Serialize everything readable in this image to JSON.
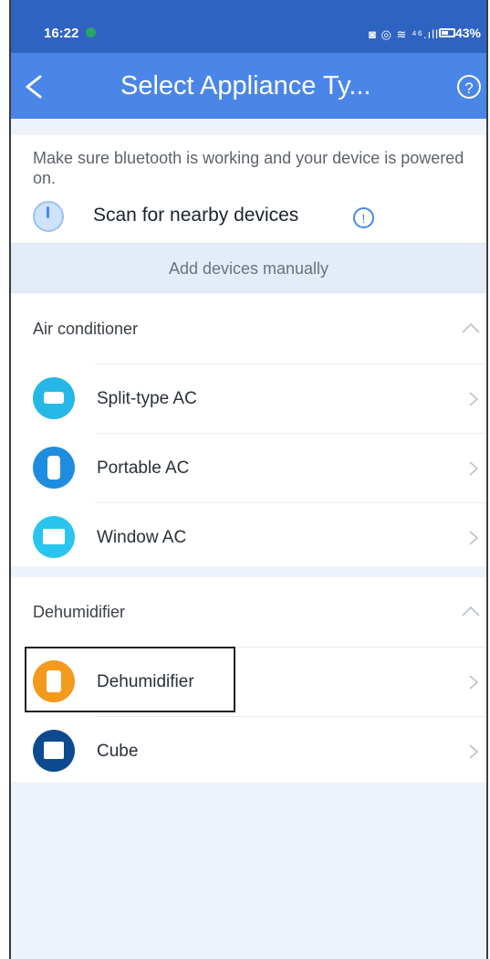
{
  "status_bar": {
    "time": "16:22",
    "icons": "◙ ◎ ≋ ⁴⁶.ıll",
    "battery": "43%"
  },
  "header": {
    "title": "Select Appliance Ty...",
    "help": "?"
  },
  "scan": {
    "hint": "Make sure bluetooth is working and your device is powered on.",
    "label": "Scan for nearby devices",
    "info": "!"
  },
  "manual": {
    "label": "Add devices manually"
  },
  "sections": [
    {
      "title": "Air conditioner",
      "items": [
        {
          "label": "Split-type AC",
          "icon": "split-ac-icon",
          "color": "#27b7e6"
        },
        {
          "label": "Portable AC",
          "icon": "portable-ac-icon",
          "color": "#1e8de0"
        },
        {
          "label": "Window AC",
          "icon": "window-ac-icon",
          "color": "#2ac5ee"
        }
      ]
    },
    {
      "title": "Dehumidifier",
      "items": [
        {
          "label": "Dehumidifier",
          "icon": "dehumidifier-icon",
          "color": "#f39a1d"
        },
        {
          "label": "Cube",
          "icon": "cube-icon",
          "color": "#0e4a8f"
        }
      ]
    }
  ],
  "colors": {
    "header": "#4a86e8",
    "status_bar": "#2f63c2",
    "background": "#eef3fb"
  }
}
